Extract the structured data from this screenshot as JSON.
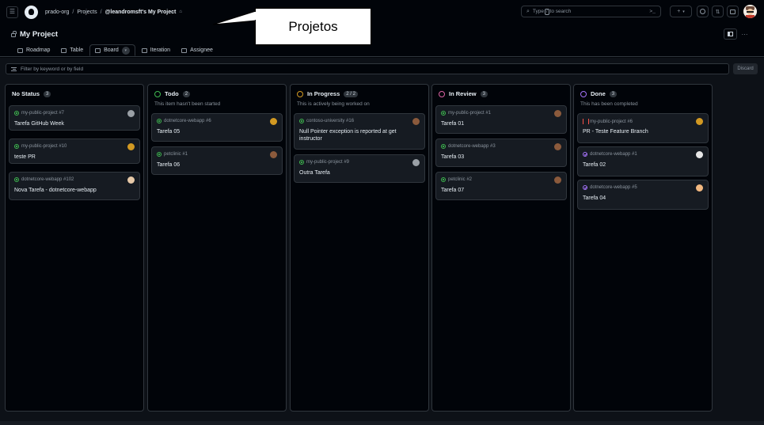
{
  "topbar": {
    "breadcrumb": {
      "org": "prado-org",
      "section": "Projects",
      "project": "@leandromsft's My Project"
    },
    "search": {
      "prefix": "Type",
      "key": "/",
      "suffix": "to search",
      "term": ">_"
    },
    "actions": {
      "plus": "+",
      "chevron": "▾"
    }
  },
  "project": {
    "title": "My Project",
    "tabs": [
      {
        "label": "Roadmap"
      },
      {
        "label": "Table"
      },
      {
        "label": "Board"
      },
      {
        "label": "Iteration"
      },
      {
        "label": "Assignee"
      }
    ],
    "active_tab": "Board",
    "more": "···"
  },
  "filter": {
    "placeholder": "Filter by keyword or by field",
    "discard": "Discard"
  },
  "columns": [
    {
      "name": "No Status",
      "count": "3",
      "description": "",
      "color": "#8b949e",
      "cards": [
        {
          "repo": "my-public-project #7",
          "title": "Tarefa GitHub Week",
          "status": "open",
          "avatar": "#9aa0a6"
        },
        {
          "repo": "my-public-project #10",
          "title": "teste PR",
          "status": "open",
          "avatar": "#d29922"
        },
        {
          "repo": "dotnetcore-webapp #102",
          "title": "Nova Tarefa - dotnetcore-webapp",
          "status": "open",
          "avatar": "#e6c9a8"
        }
      ]
    },
    {
      "name": "Todo",
      "count": "2",
      "description": "This item hasn't been started",
      "color": "#3fb950",
      "cards": [
        {
          "repo": "dotnetcore-webapp #6",
          "title": "Tarefa 05",
          "status": "open",
          "avatar": "#d29922"
        },
        {
          "repo": "petclinic #1",
          "title": "Tarefa 06",
          "status": "open",
          "avatar": "#8b5a3c"
        }
      ]
    },
    {
      "name": "In Progress",
      "count": "2 / 2",
      "description": "This is actively being worked on",
      "color": "#d29922",
      "cards": [
        {
          "repo": "contoso-university #16",
          "title": "Null Pointer exception is reported at get instructor",
          "status": "open",
          "avatar": "#8b5a3c"
        },
        {
          "repo": "my-public-project #9",
          "title": "Outra Tarefa",
          "status": "open",
          "avatar": "#9aa0a6"
        }
      ]
    },
    {
      "name": "In Review",
      "count": "3",
      "description": "",
      "color": "#db61a2",
      "cards": [
        {
          "repo": "my-public-project #1",
          "title": "Tarefa 01",
          "status": "open",
          "avatar": "#8b5a3c"
        },
        {
          "repo": "dotnetcore-webapp #3",
          "title": "Tarefa 03",
          "status": "open",
          "avatar": "#8b5a3c"
        },
        {
          "repo": "petclinic #2",
          "title": "Tarefa 07",
          "status": "open",
          "avatar": "#8b5a3c"
        }
      ]
    },
    {
      "name": "Done",
      "count": "3",
      "description": "This has been completed",
      "color": "#a371f7",
      "cards": [
        {
          "repo": "my-public-project #6",
          "title": "PR - Teste Feature Branch",
          "status": "pr",
          "avatar": "#d29922"
        },
        {
          "repo": "dotnetcore-webapp #1",
          "title": "Tarefa 02",
          "status": "done",
          "avatar": "#e6e6e6"
        },
        {
          "repo": "dotnetcore-webapp #5",
          "title": "Tarefa 04",
          "status": "done",
          "avatar": "#f2b880"
        }
      ]
    }
  ],
  "callout": {
    "text": "Projetos"
  }
}
